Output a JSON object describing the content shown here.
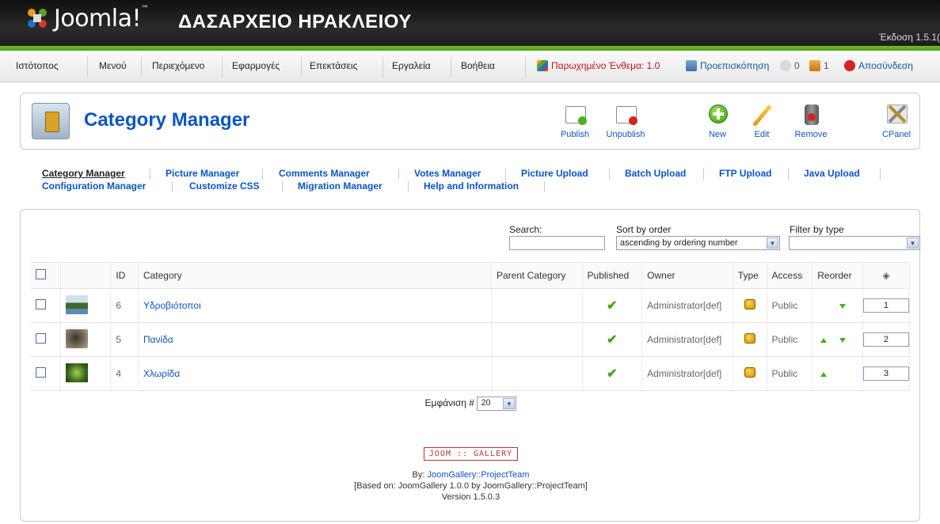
{
  "header": {
    "logo_text": "Joomla!",
    "logo_tm": "™",
    "site_name": "ΔΑΣΑΡΧΕΙΟ ΗΡΑΚΛΕΙΟΥ",
    "version": "Έκδοση 1.5.1("
  },
  "menu": {
    "items": [
      "Ιστότοπος",
      "Μενού",
      "Περιεχόμενο",
      "Εφαρμογές",
      "Επεκτάσεις",
      "Εργαλεία",
      "Βοήθεια"
    ],
    "checked_out": "Παρωχημένο Ένθεμα: 1.0",
    "preview": "Προεπισκόπηση",
    "messages": "0",
    "users": "1",
    "logout": "Αποσύνδεση"
  },
  "toolbar": {
    "title": "Category Manager",
    "publish": "Publish",
    "unpublish": "Unpublish",
    "new": "New",
    "edit": "Edit",
    "remove": "Remove",
    "cpanel": "CPanel"
  },
  "submenu": {
    "row1": [
      "Category Manager",
      "Picture Manager",
      "Comments Manager",
      "Votes Manager",
      "Picture Upload",
      "Batch Upload",
      "FTP Upload",
      "Java Upload"
    ],
    "row2": [
      "Configuration Manager",
      "Customize CSS",
      "Migration Manager",
      "Help and Information"
    ]
  },
  "filters": {
    "search_label": "Search:",
    "search_value": "",
    "sort_label": "Sort by order",
    "sort_value": "ascending by ordering number",
    "filter_label": "Filter by type",
    "filter_value": ""
  },
  "table": {
    "headers": {
      "id": "ID",
      "category": "Category",
      "parent": "Parent Category",
      "published": "Published",
      "owner": "Owner",
      "type": "Type",
      "access": "Access",
      "reorder": "Reorder"
    },
    "rows": [
      {
        "id": "6",
        "category": "Υδροβιότοποι",
        "owner": "Administrator[def]",
        "access": "Public",
        "order": "1"
      },
      {
        "id": "5",
        "category": "Πανίδα",
        "owner": "Administrator[def]",
        "access": "Public",
        "order": "2"
      },
      {
        "id": "4",
        "category": "Χλωρίδα",
        "owner": "Administrator[def]",
        "access": "Public",
        "order": "3"
      }
    ]
  },
  "pagination": {
    "label": "Εμφάνιση #",
    "value": "20"
  },
  "footer": {
    "logo": "JOOM :: GALLERY",
    "by_prefix": "By: ",
    "by_link": "JoomGallery::ProjectTeam",
    "based_on": "[Based on: JoomGallery 1.0.0 by JoomGallery::ProjectTeam]",
    "version": "Version 1.5.0.3"
  }
}
